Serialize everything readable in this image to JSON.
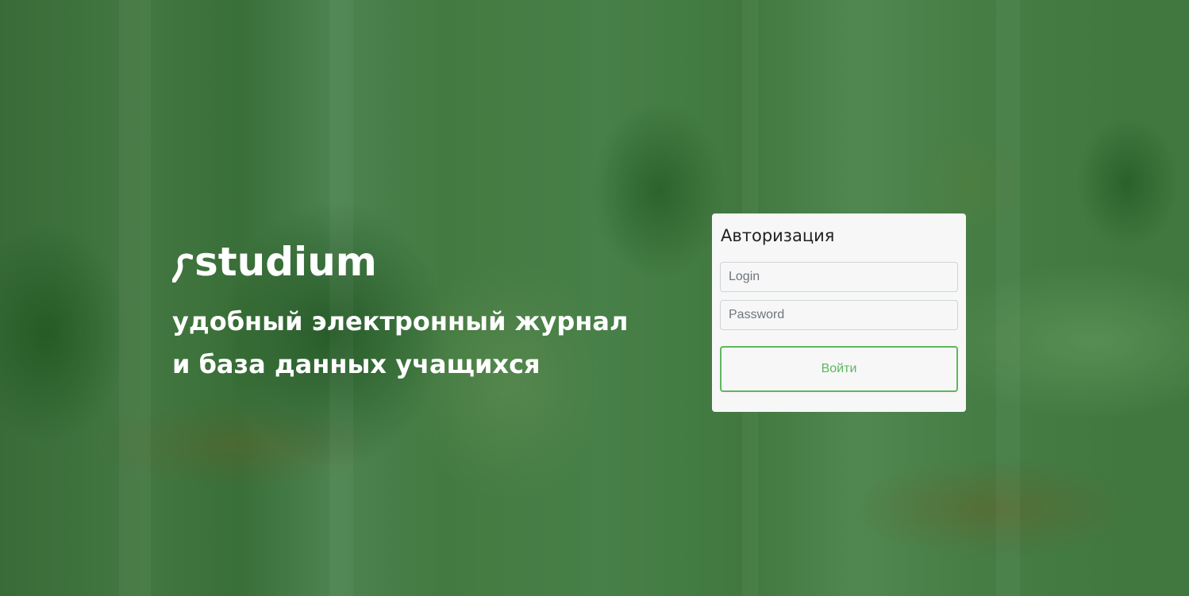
{
  "brand": {
    "logo_text": "studium",
    "tagline_line1": "удобный электронный журнал",
    "tagline_line2": "и база данных учащихся"
  },
  "auth": {
    "title": "Авторизация",
    "login_placeholder": "Login",
    "login_value": "",
    "password_placeholder": "Password",
    "password_value": "",
    "submit_label": "Войти"
  },
  "colors": {
    "background_tint": "#3f7a3f",
    "card_background": "#f7f7f7",
    "accent": "#5cb85c",
    "text_light": "#ffffff"
  },
  "icons": {
    "logo_mark": "stylized-s-logo-icon"
  }
}
